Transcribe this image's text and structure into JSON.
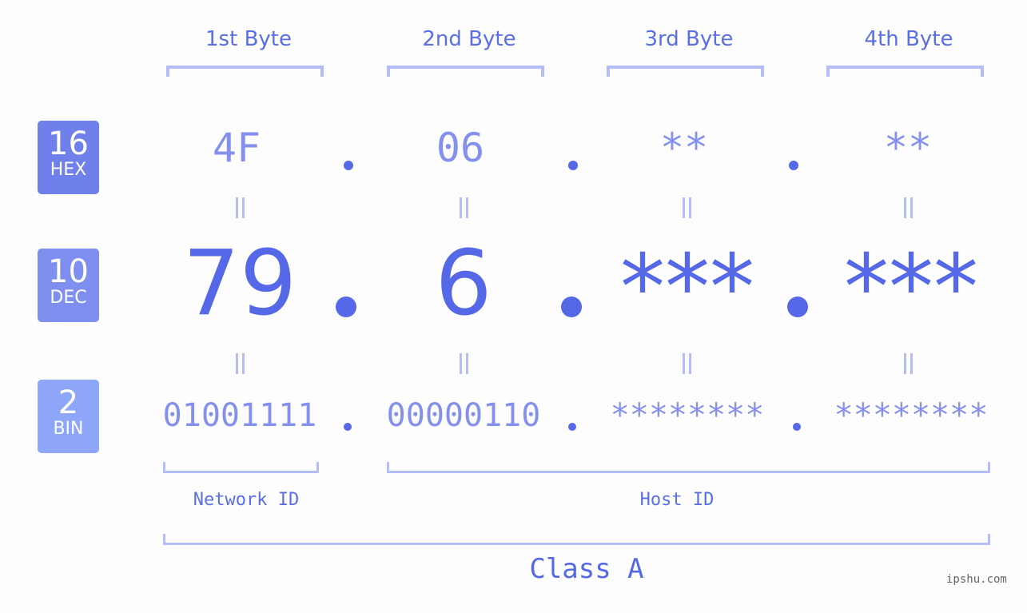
{
  "badges": [
    {
      "num": "16",
      "label": "HEX",
      "color": "#6f80eb"
    },
    {
      "num": "10",
      "label": "DEC",
      "color": "#7f8ff0"
    },
    {
      "num": "2",
      "label": "BIN",
      "color": "#8ea6f7"
    }
  ],
  "headers": [
    "1st Byte",
    "2nd Byte",
    "3rd Byte",
    "4th Byte"
  ],
  "hex": [
    "4F",
    "06",
    "**",
    "**"
  ],
  "dec": [
    "79",
    "6",
    "***",
    "***"
  ],
  "bin": [
    "01001111",
    "00000110",
    "********",
    "********"
  ],
  "network_id_label": "Network ID",
  "host_id_label": "Host ID",
  "class_label": "Class A",
  "watermark": "ipshu.com"
}
